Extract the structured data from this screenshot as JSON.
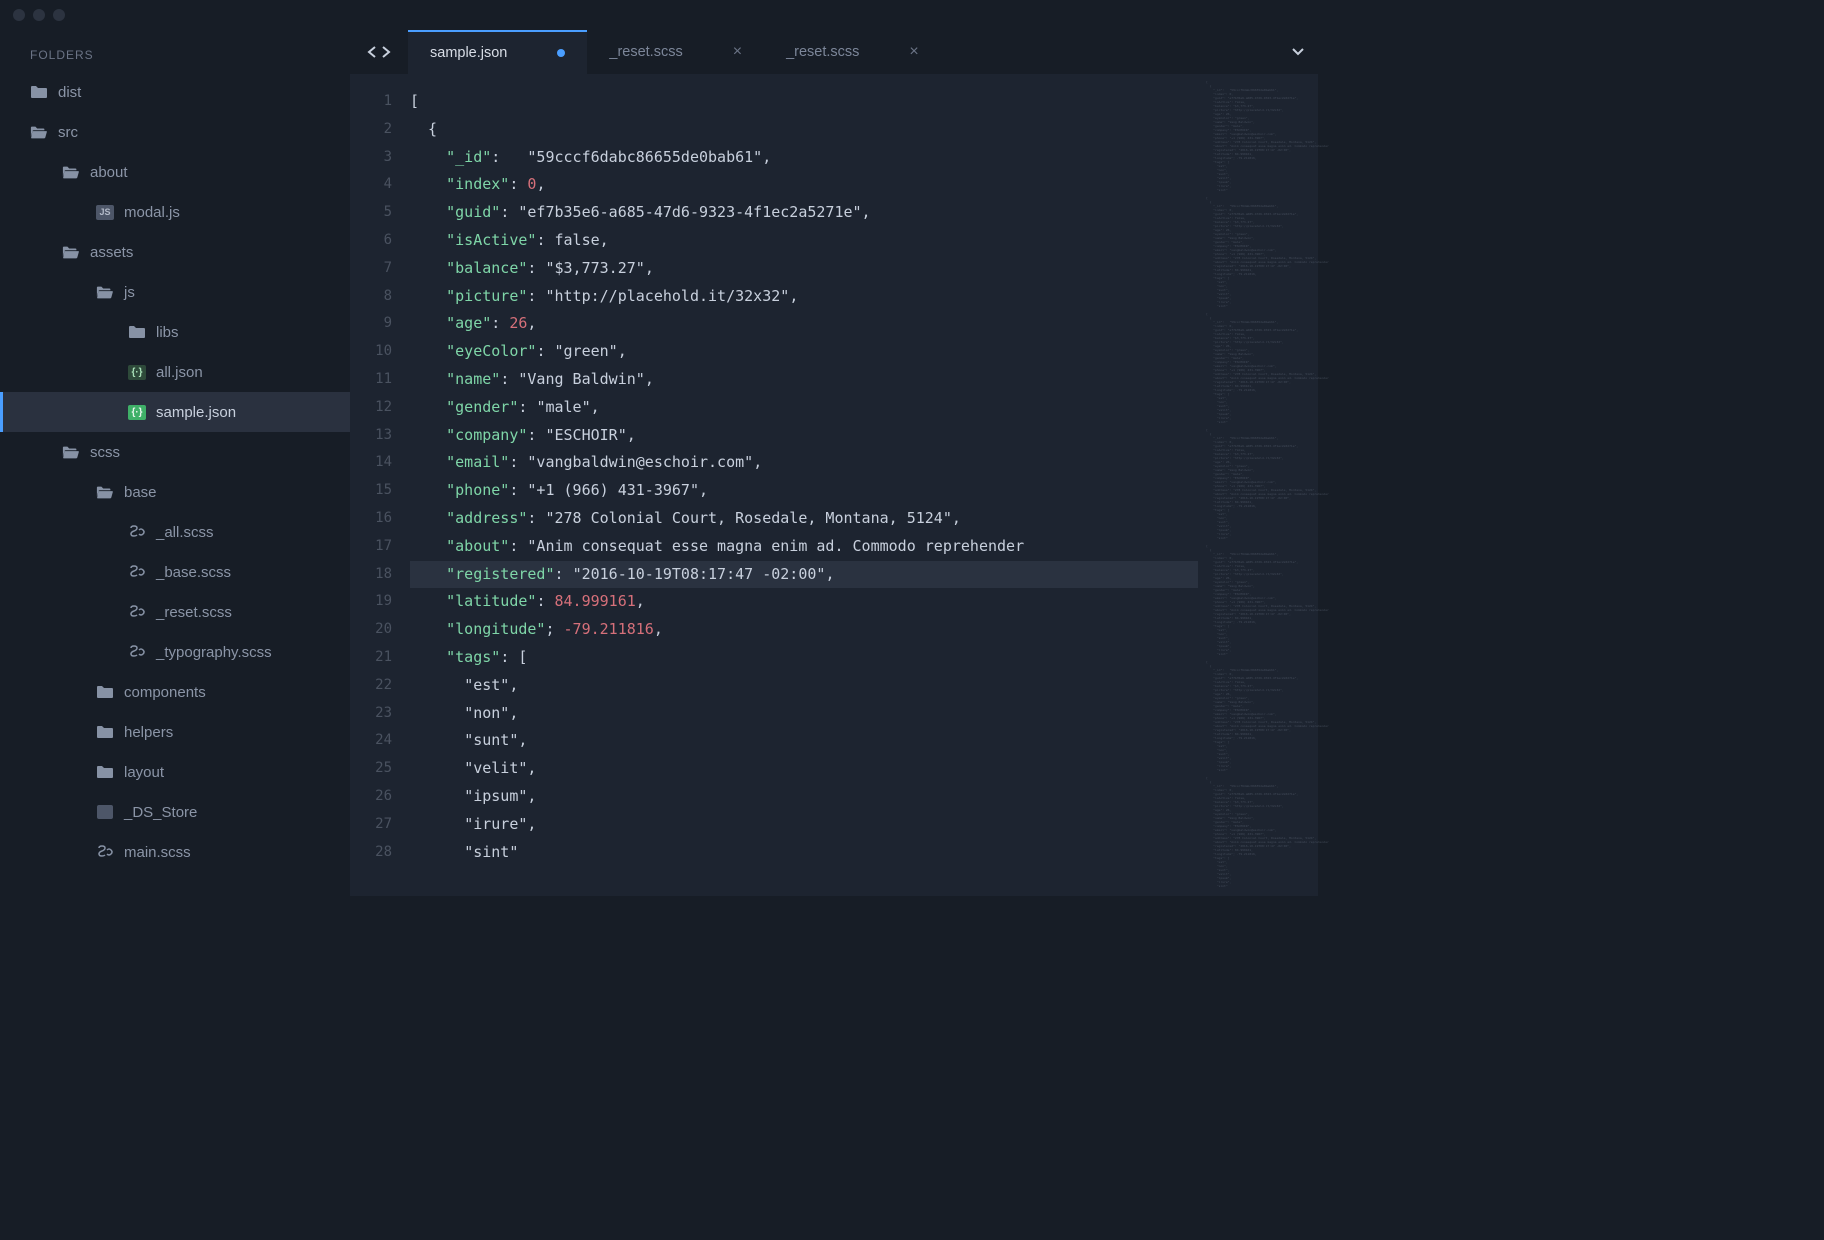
{
  "sidebar": {
    "header": "FOLDERS",
    "tree": [
      {
        "label": "dist",
        "icon": "folder",
        "indent": 0
      },
      {
        "label": "src",
        "icon": "folder-open",
        "indent": 0
      },
      {
        "label": "about",
        "icon": "folder-open",
        "indent": 1
      },
      {
        "label": "modal.js",
        "icon": "js",
        "indent": 2
      },
      {
        "label": "assets",
        "icon": "folder-open",
        "indent": 1
      },
      {
        "label": "js",
        "icon": "folder-open",
        "indent": 2
      },
      {
        "label": "libs",
        "icon": "folder",
        "indent": 3
      },
      {
        "label": "all.json",
        "icon": "json",
        "indent": 3
      },
      {
        "label": "sample.json",
        "icon": "json-active",
        "indent": 3,
        "selected": true
      },
      {
        "label": "scss",
        "icon": "folder-open",
        "indent": 1
      },
      {
        "label": "base",
        "icon": "folder-open",
        "indent": 2
      },
      {
        "label": "_all.scss",
        "icon": "scss",
        "indent": 3
      },
      {
        "label": "_base.scss",
        "icon": "scss",
        "indent": 3
      },
      {
        "label": "_reset.scss",
        "icon": "scss",
        "indent": 3
      },
      {
        "label": "_typography.scss",
        "icon": "scss",
        "indent": 3
      },
      {
        "label": "components",
        "icon": "folder",
        "indent": 2
      },
      {
        "label": "helpers",
        "icon": "folder",
        "indent": 2
      },
      {
        "label": "layout",
        "icon": "folder",
        "indent": 2
      },
      {
        "label": "_DS_Store",
        "icon": "ds",
        "indent": 2
      },
      {
        "label": "main.scss",
        "icon": "scss",
        "indent": 2
      }
    ]
  },
  "tabs": [
    {
      "label": "sample.json",
      "active": true,
      "dirty": true
    },
    {
      "label": "_reset.scss",
      "active": false,
      "dirty": false
    },
    {
      "label": "_reset.scss",
      "active": false,
      "dirty": false
    }
  ],
  "editor": {
    "highlighted_line": 18,
    "lines": [
      {
        "num": 1,
        "tokens": [
          {
            "t": "[",
            "c": "p"
          }
        ]
      },
      {
        "num": 2,
        "tokens": [
          {
            "t": "  {",
            "c": "p"
          }
        ]
      },
      {
        "num": 3,
        "tokens": [
          {
            "t": "    ",
            "c": "p"
          },
          {
            "t": "\"_id\"",
            "c": "k"
          },
          {
            "t": ":   ",
            "c": "p"
          },
          {
            "t": "\"59cccf6dabc86655de0bab61\"",
            "c": "s"
          },
          {
            "t": ",",
            "c": "p"
          }
        ]
      },
      {
        "num": 4,
        "tokens": [
          {
            "t": "    ",
            "c": "p"
          },
          {
            "t": "\"index\"",
            "c": "k"
          },
          {
            "t": ": ",
            "c": "p"
          },
          {
            "t": "0",
            "c": "n"
          },
          {
            "t": ",",
            "c": "p"
          }
        ]
      },
      {
        "num": 5,
        "tokens": [
          {
            "t": "    ",
            "c": "p"
          },
          {
            "t": "\"guid\"",
            "c": "k"
          },
          {
            "t": ": ",
            "c": "p"
          },
          {
            "t": "\"ef7b35e6-a685-47d6-9323-4f1ec2a5271e\"",
            "c": "s"
          },
          {
            "t": ",",
            "c": "p"
          }
        ]
      },
      {
        "num": 6,
        "tokens": [
          {
            "t": "    ",
            "c": "p"
          },
          {
            "t": "\"isActive\"",
            "c": "k"
          },
          {
            "t": ": ",
            "c": "p"
          },
          {
            "t": "false",
            "c": "b"
          },
          {
            "t": ",",
            "c": "p"
          }
        ]
      },
      {
        "num": 7,
        "tokens": [
          {
            "t": "    ",
            "c": "p"
          },
          {
            "t": "\"balance\"",
            "c": "k"
          },
          {
            "t": ": ",
            "c": "p"
          },
          {
            "t": "\"$3,773.27\"",
            "c": "s"
          },
          {
            "t": ",",
            "c": "p"
          }
        ]
      },
      {
        "num": 8,
        "tokens": [
          {
            "t": "    ",
            "c": "p"
          },
          {
            "t": "\"picture\"",
            "c": "k"
          },
          {
            "t": ": ",
            "c": "p"
          },
          {
            "t": "\"http://placehold.it/32x32\"",
            "c": "s"
          },
          {
            "t": ",",
            "c": "p"
          }
        ]
      },
      {
        "num": 9,
        "tokens": [
          {
            "t": "    ",
            "c": "p"
          },
          {
            "t": "\"age\"",
            "c": "k"
          },
          {
            "t": ": ",
            "c": "p"
          },
          {
            "t": "26",
            "c": "n"
          },
          {
            "t": ",",
            "c": "p"
          }
        ]
      },
      {
        "num": 10,
        "tokens": [
          {
            "t": "    ",
            "c": "p"
          },
          {
            "t": "\"eyeColor\"",
            "c": "k"
          },
          {
            "t": ": ",
            "c": "p"
          },
          {
            "t": "\"green\"",
            "c": "s"
          },
          {
            "t": ",",
            "c": "p"
          }
        ]
      },
      {
        "num": 11,
        "tokens": [
          {
            "t": "    ",
            "c": "p"
          },
          {
            "t": "\"name\"",
            "c": "k"
          },
          {
            "t": ": ",
            "c": "p"
          },
          {
            "t": "\"Vang Baldwin\"",
            "c": "s"
          },
          {
            "t": ",",
            "c": "p"
          }
        ]
      },
      {
        "num": 12,
        "tokens": [
          {
            "t": "    ",
            "c": "p"
          },
          {
            "t": "\"gender\"",
            "c": "k"
          },
          {
            "t": ": ",
            "c": "p"
          },
          {
            "t": "\"male\"",
            "c": "s"
          },
          {
            "t": ",",
            "c": "p"
          }
        ]
      },
      {
        "num": 13,
        "tokens": [
          {
            "t": "    ",
            "c": "p"
          },
          {
            "t": "\"company\"",
            "c": "k"
          },
          {
            "t": ": ",
            "c": "p"
          },
          {
            "t": "\"ESCHOIR\"",
            "c": "s"
          },
          {
            "t": ",",
            "c": "p"
          }
        ]
      },
      {
        "num": 14,
        "tokens": [
          {
            "t": "    ",
            "c": "p"
          },
          {
            "t": "\"email\"",
            "c": "k"
          },
          {
            "t": ": ",
            "c": "p"
          },
          {
            "t": "\"vangbaldwin@eschoir.com\"",
            "c": "s"
          },
          {
            "t": ",",
            "c": "p"
          }
        ]
      },
      {
        "num": 15,
        "tokens": [
          {
            "t": "    ",
            "c": "p"
          },
          {
            "t": "\"phone\"",
            "c": "k"
          },
          {
            "t": ": ",
            "c": "p"
          },
          {
            "t": "\"+1 (966) 431-3967\"",
            "c": "s"
          },
          {
            "t": ",",
            "c": "p"
          }
        ]
      },
      {
        "num": 16,
        "tokens": [
          {
            "t": "    ",
            "c": "p"
          },
          {
            "t": "\"address\"",
            "c": "k"
          },
          {
            "t": ": ",
            "c": "p"
          },
          {
            "t": "\"278 Colonial Court, Rosedale, Montana, 5124\"",
            "c": "s"
          },
          {
            "t": ",",
            "c": "p"
          }
        ]
      },
      {
        "num": 17,
        "tokens": [
          {
            "t": "    ",
            "c": "p"
          },
          {
            "t": "\"about\"",
            "c": "k"
          },
          {
            "t": ": ",
            "c": "p"
          },
          {
            "t": "\"Anim consequat esse magna enim ad. Commodo reprehender",
            "c": "s"
          }
        ]
      },
      {
        "num": 18,
        "tokens": [
          {
            "t": "    ",
            "c": "p"
          },
          {
            "t": "\"registered\"",
            "c": "k"
          },
          {
            "t": ": ",
            "c": "p"
          },
          {
            "t": "\"2016-10-19T08:17:47 -02:00\"",
            "c": "s"
          },
          {
            "t": ",",
            "c": "p"
          }
        ]
      },
      {
        "num": 19,
        "tokens": [
          {
            "t": "    ",
            "c": "p"
          },
          {
            "t": "\"latitude\"",
            "c": "k"
          },
          {
            "t": ": ",
            "c": "p"
          },
          {
            "t": "84.999161",
            "c": "n"
          },
          {
            "t": ",",
            "c": "p"
          }
        ]
      },
      {
        "num": 20,
        "tokens": [
          {
            "t": "    ",
            "c": "p"
          },
          {
            "t": "\"longitude\"",
            "c": "k"
          },
          {
            "t": "; ",
            "c": "p"
          },
          {
            "t": "-79.211816",
            "c": "n"
          },
          {
            "t": ",",
            "c": "p"
          }
        ]
      },
      {
        "num": 21,
        "tokens": [
          {
            "t": "    ",
            "c": "p"
          },
          {
            "t": "\"tags\"",
            "c": "k"
          },
          {
            "t": ": [",
            "c": "p"
          }
        ]
      },
      {
        "num": 22,
        "tokens": [
          {
            "t": "      ",
            "c": "p"
          },
          {
            "t": "\"est\"",
            "c": "s"
          },
          {
            "t": ",",
            "c": "p"
          }
        ]
      },
      {
        "num": 23,
        "tokens": [
          {
            "t": "      ",
            "c": "p"
          },
          {
            "t": "\"non\"",
            "c": "s"
          },
          {
            "t": ",",
            "c": "p"
          }
        ]
      },
      {
        "num": 24,
        "tokens": [
          {
            "t": "      ",
            "c": "p"
          },
          {
            "t": "\"sunt\"",
            "c": "s"
          },
          {
            "t": ",",
            "c": "p"
          }
        ]
      },
      {
        "num": 25,
        "tokens": [
          {
            "t": "      ",
            "c": "p"
          },
          {
            "t": "\"velit\"",
            "c": "s"
          },
          {
            "t": ",",
            "c": "p"
          }
        ]
      },
      {
        "num": 26,
        "tokens": [
          {
            "t": "      ",
            "c": "p"
          },
          {
            "t": "\"ipsum\"",
            "c": "s"
          },
          {
            "t": ",",
            "c": "p"
          }
        ]
      },
      {
        "num": 27,
        "tokens": [
          {
            "t": "      ",
            "c": "p"
          },
          {
            "t": "\"irure\"",
            "c": "s"
          },
          {
            "t": ",",
            "c": "p"
          }
        ]
      },
      {
        "num": 28,
        "tokens": [
          {
            "t": "      ",
            "c": "p"
          },
          {
            "t": "\"sint\"",
            "c": "s"
          }
        ]
      }
    ]
  }
}
